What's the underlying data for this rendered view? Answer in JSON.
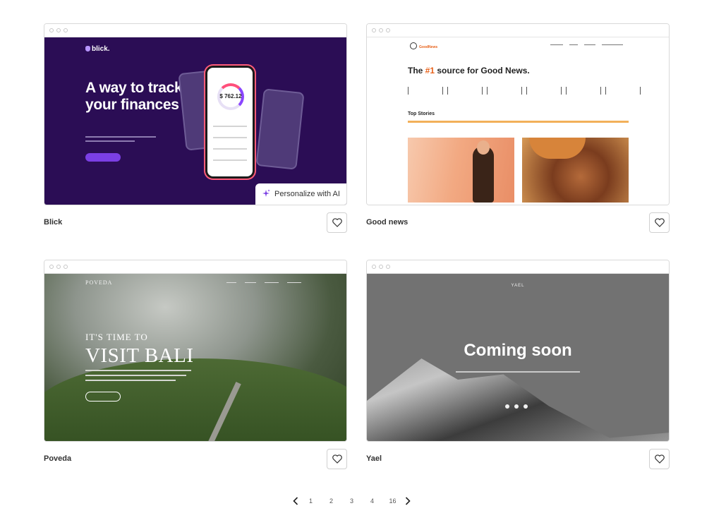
{
  "cards": [
    {
      "title": "Blick",
      "preview": {
        "logo": "blick.",
        "headline": "A way to track your finances",
        "amount": "$ 762.12",
        "ai_button": "Personalize with AI"
      }
    },
    {
      "title": "Good news",
      "preview": {
        "logo": "GoodNews",
        "headline_prefix": "The ",
        "headline_highlight": "#1",
        "headline_suffix": " source for Good News.",
        "section": "Top Stories"
      }
    },
    {
      "title": "Poveda",
      "preview": {
        "logo": "POVEDA",
        "kicker": "IT'S TIME TO",
        "headline": "VISIT BALI"
      }
    },
    {
      "title": "Yael",
      "preview": {
        "logo": "YAEL",
        "headline": "Coming soon"
      }
    }
  ],
  "pagination": {
    "pages": [
      "1",
      "2",
      "3",
      "4",
      "16"
    ]
  },
  "icons": {
    "favorite": "heart-icon",
    "prev": "chevron-left-icon",
    "next": "chevron-right-icon",
    "ai": "sparkle-icon"
  },
  "colors": {
    "blick_bg": "#2b0d55",
    "accent_orange": "#e8631c",
    "yael_bg": "#727272"
  }
}
